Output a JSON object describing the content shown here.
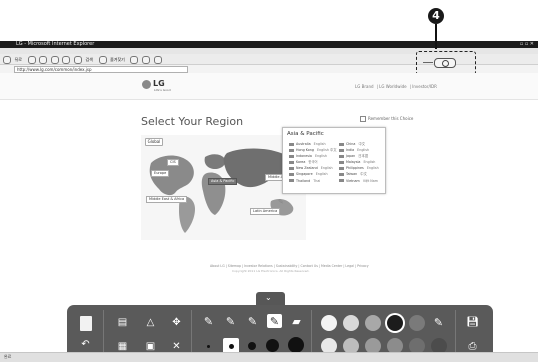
{
  "browser": {
    "title": "LG - Microsoft Internet Explorer",
    "menu": [
      "파일(F)",
      "편집(E)",
      "보기(V)",
      "즐겨찾기(A)",
      "도구(T)",
      "도움말(H)"
    ],
    "toolbar_labels": [
      "뒤로",
      "검색",
      "즐겨찾기"
    ],
    "address": "http://www.lg.com/common/index.jsp",
    "status": "완료"
  },
  "callout": {
    "number": "4"
  },
  "site": {
    "logo_text": "LG",
    "logo_sub": "Life's Good",
    "header_links": [
      "LG Brand",
      "LG Worldwide",
      "Investor/IDR"
    ],
    "page_title": "Select Your Region",
    "remember_label": "Remember this Choice",
    "map_tab": "Global",
    "regions": [
      "Europe",
      "CIS",
      "Asia & Pacific",
      "Middle America",
      "Middle East & Africa",
      "Latin America"
    ],
    "popup": {
      "title": "Asia & Pacific",
      "col1": [
        {
          "country": "Australia",
          "lang": "English"
        },
        {
          "country": "Hong Kong",
          "lang": "English  中文"
        },
        {
          "country": "Indonesia",
          "lang": "English"
        },
        {
          "country": "Korea",
          "lang": "한국어"
        },
        {
          "country": "New Zealand",
          "lang": "English"
        },
        {
          "country": "Singapore",
          "lang": "English"
        },
        {
          "country": "Thailand",
          "lang": "Thai"
        }
      ],
      "col2": [
        {
          "country": "China",
          "lang": "中文"
        },
        {
          "country": "India",
          "lang": "English"
        },
        {
          "country": "Japan",
          "lang": "日本語"
        },
        {
          "country": "Malaysia",
          "lang": "English"
        },
        {
          "country": "Philippines",
          "lang": "English"
        },
        {
          "country": "Taiwan",
          "lang": "中文"
        },
        {
          "country": "Vietnam",
          "lang": "Việt Nam"
        }
      ]
    },
    "footer_links": "About LG  |  Sitemap  |  Investor Relations  |  Sustainability  |  Contact Us  |  Media Center  |  Legal  |  Privacy",
    "copyright": "Copyright 2011 LG Electronics. All Rights Reserved."
  },
  "drawer": {
    "colors_top": [
      "#f4f4f4",
      "#d9d9d9",
      "#a8a8a8",
      "#1c1c1c",
      "#7a7a7a",
      "#cfcfcf"
    ],
    "colors_bottom": [
      "#e8e8e8",
      "#bdbdbd",
      "#9a9a9a",
      "#8c8c8c",
      "#6e6e6e",
      "#4c4c4c"
    ],
    "accent": "#5a5a5a"
  }
}
